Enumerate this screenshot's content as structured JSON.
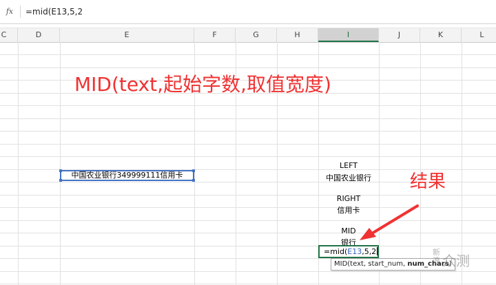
{
  "formula_bar": {
    "fx_label": "fx",
    "formula": "=mid(E13,5,2"
  },
  "columns": [
    {
      "label": "C"
    },
    {
      "label": "D"
    },
    {
      "label": "E"
    },
    {
      "label": "F"
    },
    {
      "label": "G"
    },
    {
      "label": "H"
    },
    {
      "label": "I"
    },
    {
      "label": "J"
    },
    {
      "label": "K"
    },
    {
      "label": "L"
    }
  ],
  "active_column": "I",
  "cells": {
    "e13": "中国农业银行349999111信用卡",
    "left_label": "LEFT",
    "left_result": "中国农业银行",
    "right_label": "RIGHT",
    "right_result": "信用卡",
    "mid_label": "MID",
    "mid_result": "银行"
  },
  "editing_cell": {
    "prefix": "=mid(",
    "ref": "E13",
    "suffix": ",5,2"
  },
  "tooltip": {
    "text_before": "MID(text, start_num, ",
    "bold_arg": "num_chars",
    "text_after": ")"
  },
  "annotations": {
    "title": "MID(text,起始字数,取值宽度)",
    "result": "结果",
    "color": "#f03232"
  },
  "watermark": {
    "logo": "新 浪",
    "text": "众测"
  }
}
